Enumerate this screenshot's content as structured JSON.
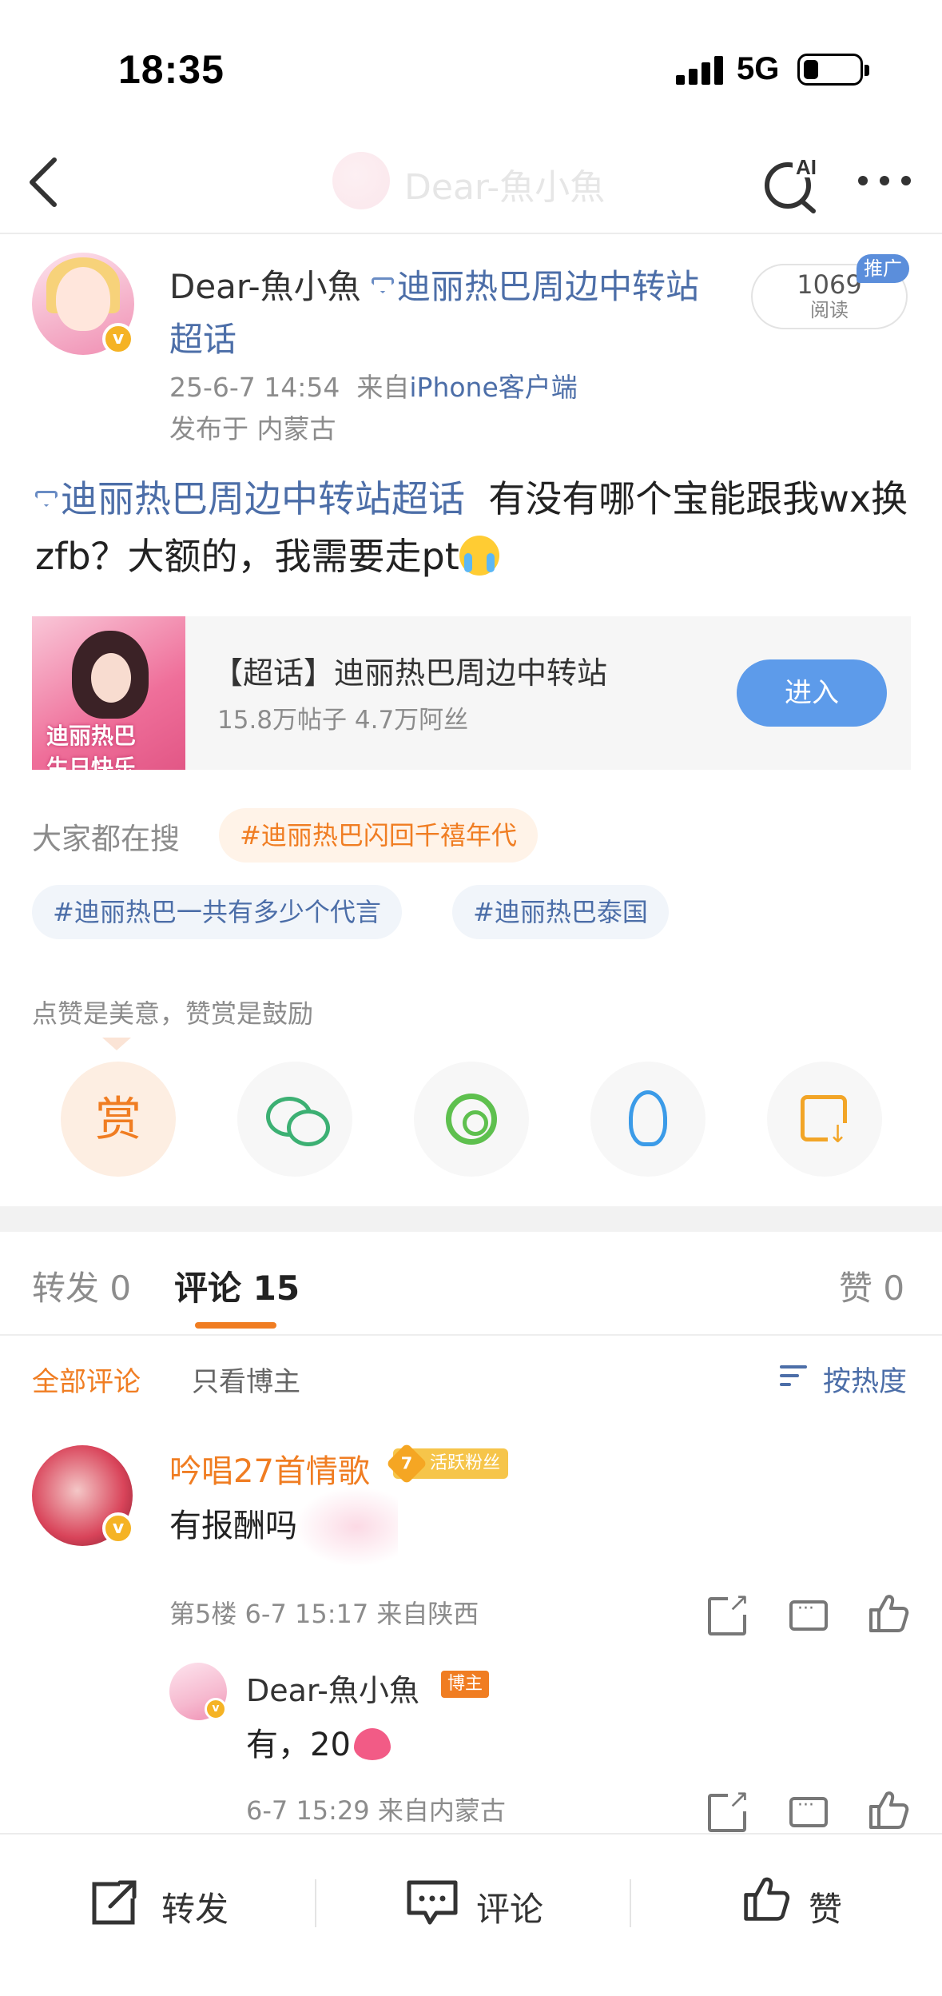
{
  "status_bar": {
    "time": "18:35",
    "network": "5G"
  },
  "nav": {
    "title": "Dear-魚小魚",
    "ai_label": "AI"
  },
  "post": {
    "author": "Dear-魚小魚",
    "topic_name": "迪丽热巴周边中转站超话",
    "timestamp": "25-6-7 14:54",
    "from_prefix": "来自",
    "source": "iPhone客户端",
    "location": "发布于 内蒙古",
    "read_count": "1069",
    "read_label": "阅读",
    "promo_tag": "推广",
    "body_topic": "迪丽热巴周边中转站超话",
    "body_text": "有没有哪个宝能跟我wx换zfb？大额的，我需要走pt"
  },
  "topic_card": {
    "thumb_text": "迪丽热巴 生日快乐",
    "title": "【超话】迪丽热巴周边中转站",
    "stats": "15.8万帖子 4.7万阿丝",
    "enter_label": "进入"
  },
  "searches": {
    "label": "大家都在搜",
    "chips": [
      "#迪丽热巴闪回千禧年代",
      "#迪丽热巴一共有多少个代言",
      "#迪丽热巴泰国"
    ]
  },
  "reward": {
    "text": "点赞是美意，赞赏是鼓励",
    "reward_label": "赏",
    "share_targets": [
      "wechat-icon",
      "moments-icon",
      "qq-icon",
      "save-image-icon"
    ]
  },
  "tabs": {
    "repost": "转发 0",
    "comment": "评论 15",
    "like": "赞 0"
  },
  "filters": {
    "all": "全部评论",
    "owner": "只看博主",
    "sort": "按热度"
  },
  "comments": [
    {
      "name": "吟唱27首情歌",
      "fan_level": "7",
      "fan_label": "活跃粉丝",
      "text": "有报酬吗",
      "meta": "第5楼 6-7 15:17 来自陕西",
      "reply": {
        "name": "Dear-魚小魚",
        "badge": "博主",
        "text": "有，20",
        "meta": "6-7 15:29 来自内蒙古"
      }
    }
  ],
  "bottom_bar": {
    "repost": "转发",
    "comment": "评论",
    "like": "赞"
  },
  "colors": {
    "accent": "#f07d22",
    "link": "#4c6ea8",
    "enter": "#5d9bea"
  }
}
